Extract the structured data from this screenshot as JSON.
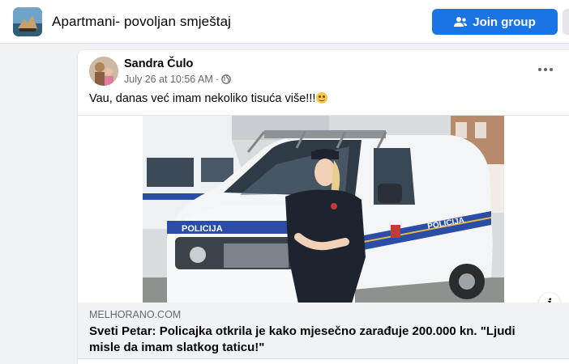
{
  "group": {
    "name": "Apartmani- povoljan smještaj",
    "join_label": "Join group",
    "join_icon": "people-add-icon",
    "accent": "#1b74e4"
  },
  "post": {
    "author": "Sandra Čulo",
    "date": "July 26 at 10:56 AM",
    "separator": "·",
    "privacy_icon": "globe-icon",
    "text": "Vau, danas već imam nekoliko tisuća više!!!",
    "emoji": "grinning-face-emoji",
    "options_icon": "more-horizontal-icon"
  },
  "link": {
    "domain": "MELHORANO.COM",
    "title": "Sveti Petar: Policajka otkrila je kako mjesečno zarađuje 200.000 kn. \"Ljudi misle da imam slatkog taticu!\"",
    "image_text_front": "POLICIJA",
    "image_text_side": "POLICIJA",
    "info_label": "i"
  }
}
